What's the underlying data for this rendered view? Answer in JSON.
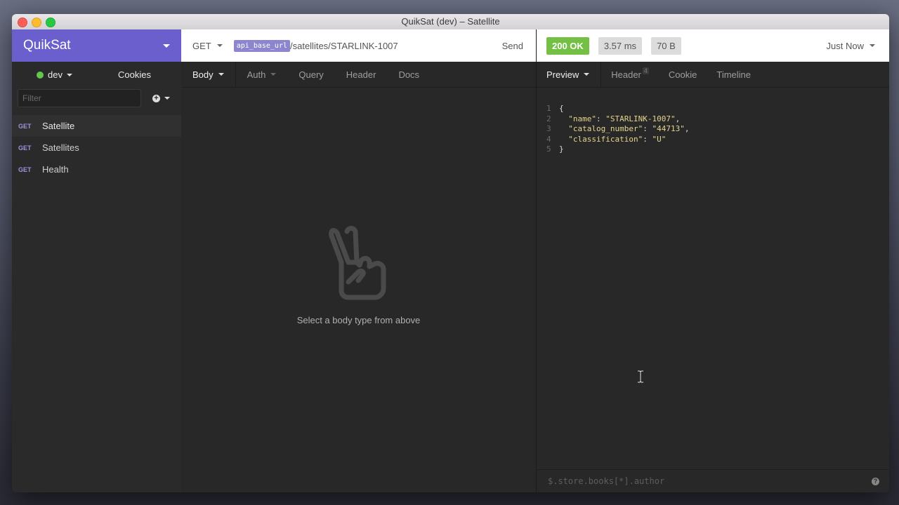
{
  "window": {
    "title": "QuikSat (dev) – Satellite"
  },
  "sidebar": {
    "workspace": "QuikSat",
    "environment": "dev",
    "cookies_label": "Cookies",
    "filter_placeholder": "Filter",
    "requests": [
      {
        "method": "GET",
        "name": "Satellite",
        "active": true
      },
      {
        "method": "GET",
        "name": "Satellites",
        "active": false
      },
      {
        "method": "GET",
        "name": "Health",
        "active": false
      }
    ]
  },
  "request": {
    "method": "GET",
    "url_variable": "api_base_url",
    "url_path": "/satellites/STARLINK-1007",
    "send_label": "Send",
    "tabs": [
      "Body",
      "Auth",
      "Query",
      "Header",
      "Docs"
    ],
    "empty_message": "Select a body type from above"
  },
  "response": {
    "status": "200 OK",
    "time": "3.57 ms",
    "size": "70 B",
    "history": "Just Now",
    "tabs": [
      "Preview",
      "Header",
      "Cookie",
      "Timeline"
    ],
    "header_count": "4",
    "body_lines": [
      {
        "n": "1",
        "text": "{"
      },
      {
        "n": "2",
        "key": "\"name\"",
        "value": "\"STARLINK-1007\"",
        "trail": ","
      },
      {
        "n": "3",
        "key": "\"catalog_number\"",
        "value": "\"44713\"",
        "trail": ","
      },
      {
        "n": "4",
        "key": "\"classification\"",
        "value": "\"U\"",
        "trail": ""
      },
      {
        "n": "5",
        "text": "}"
      }
    ],
    "filter_placeholder": "$.store.books[*].author"
  },
  "colors": {
    "accent": "#6b5fce",
    "status_ok": "#73c045",
    "env_dot": "#63c74d"
  }
}
